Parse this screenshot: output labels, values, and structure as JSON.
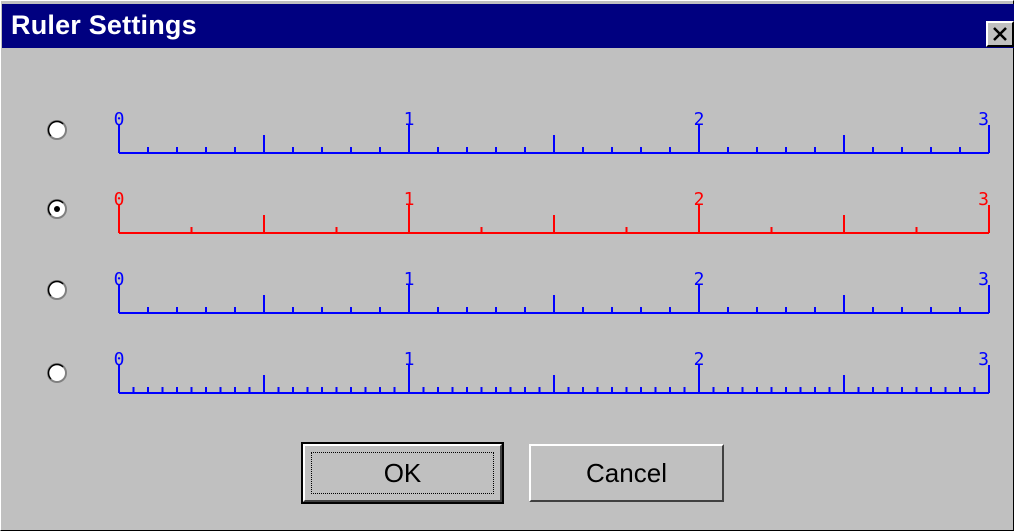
{
  "window": {
    "title": "Ruler Settings",
    "close_icon": "close-icon"
  },
  "rulers": [
    {
      "selected": false,
      "color": "#0000ff",
      "labels": [
        "0",
        "1",
        "2",
        "3"
      ],
      "subdivisions": 10
    },
    {
      "selected": true,
      "color": "#ff0000",
      "labels": [
        "0",
        "1",
        "2",
        "3"
      ],
      "subdivisions": 4
    },
    {
      "selected": false,
      "color": "#0000ff",
      "labels": [
        "0",
        "1",
        "2",
        "3"
      ],
      "subdivisions": 10
    },
    {
      "selected": false,
      "color": "#0000ff",
      "labels": [
        "0",
        "1",
        "2",
        "3"
      ],
      "subdivisions": 20
    }
  ],
  "buttons": {
    "ok": "OK",
    "cancel": "Cancel"
  }
}
